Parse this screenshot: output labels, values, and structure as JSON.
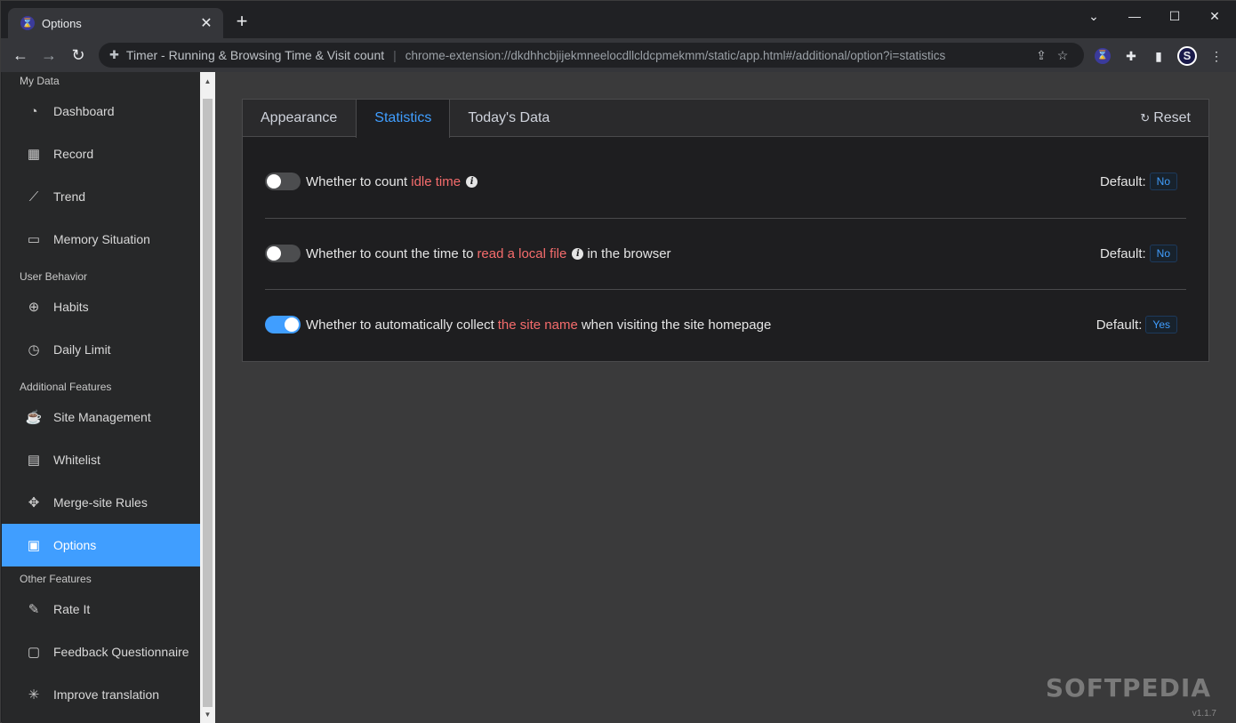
{
  "browser": {
    "tab_title": "Options",
    "tab_favicon": "⌛",
    "new_tab": "+",
    "omnibox_title": "Timer - Running & Browsing Time & Visit count",
    "omnibox_url": "chrome-extension://dkdhhcbjijekmneelocdllcldcpmekmm/static/app.html#/additional/option?i=statistics",
    "profile_initial": "S"
  },
  "sidebar": {
    "groups": [
      {
        "label": "My Data",
        "items": [
          {
            "label": "Dashboard",
            "icon": "dashboard-icon"
          },
          {
            "label": "Record",
            "icon": "calendar-icon"
          },
          {
            "label": "Trend",
            "icon": "trend-icon"
          },
          {
            "label": "Memory Situation",
            "icon": "folder-icon"
          }
        ]
      },
      {
        "label": "User Behavior",
        "items": [
          {
            "label": "Habits",
            "icon": "crosshair-icon"
          },
          {
            "label": "Daily Limit",
            "icon": "timer-icon"
          }
        ]
      },
      {
        "label": "Additional Features",
        "items": [
          {
            "label": "Site Management",
            "icon": "cup-icon"
          },
          {
            "label": "Whitelist",
            "icon": "document-icon"
          },
          {
            "label": "Merge-site Rules",
            "icon": "move-icon"
          },
          {
            "label": "Options",
            "icon": "options-icon"
          }
        ]
      },
      {
        "label": "Other Features",
        "items": [
          {
            "label": "Rate It",
            "icon": "candy-icon"
          },
          {
            "label": "Feedback Questionnaire",
            "icon": "chat-icon"
          },
          {
            "label": "Improve translation",
            "icon": "loading-icon"
          }
        ]
      }
    ]
  },
  "options": {
    "tabs": [
      "Appearance",
      "Statistics",
      "Today's Data"
    ],
    "active_tab": "Statistics",
    "reset_label": "Reset",
    "rows": [
      {
        "prefix": "Whether to count",
        "highlight": "idle time",
        "suffix": "",
        "has_info": true,
        "enabled": false,
        "default_label": "Default:",
        "default_value": "No"
      },
      {
        "prefix": "Whether to count the time to",
        "highlight": "read a local file",
        "suffix": "in the browser",
        "has_info": true,
        "enabled": false,
        "default_label": "Default:",
        "default_value": "No"
      },
      {
        "prefix": "Whether to automatically collect",
        "highlight": "the site name",
        "suffix": "when visiting the site homepage",
        "has_info": false,
        "enabled": true,
        "default_label": "Default:",
        "default_value": "Yes"
      }
    ]
  },
  "watermark": "SOFTPEDIA",
  "version": "v1.1.7",
  "colors": {
    "accent": "#409eff",
    "highlight": "#f56c6c"
  }
}
